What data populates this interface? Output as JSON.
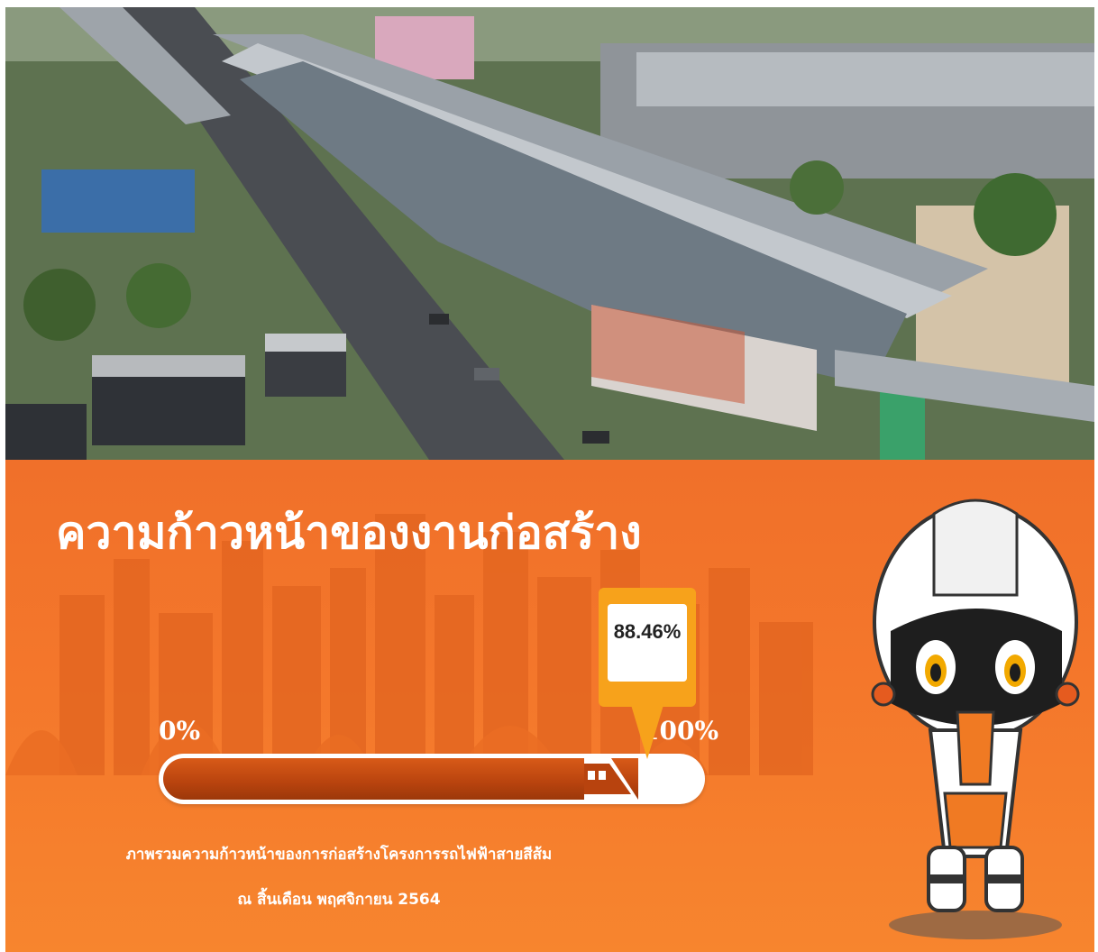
{
  "headline": "ความก้าวหน้าของงานก่อสร้าง",
  "progress": {
    "percent": 88.46,
    "percent_label": "88.46%",
    "start_label": "0%",
    "end_label": "100%"
  },
  "caption": {
    "line1": "ภาพรวมความก้าวหน้าของการก่อสร้างโครงการรถไฟฟ้าสายสีส้ม",
    "line2": "ณ สิ้นเดือน พฤศจิกายน 2564"
  },
  "colors": {
    "panel": "#f4772b",
    "bar_fill": "#b8430e",
    "marker": "#f7a21b",
    "track": "#ffffff"
  }
}
